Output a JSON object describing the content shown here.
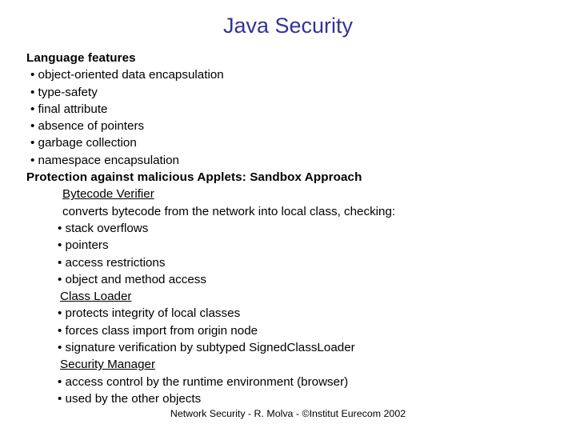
{
  "slide": {
    "title": "Java Security",
    "title_color": "#333399",
    "background_color": "#FFFFFF",
    "text_color": "#000000",
    "bullet_glyph": "•"
  },
  "content": {
    "lines": [
      {
        "text": "Language features",
        "style": "bold",
        "indent": "ind-0"
      },
      {
        "text": "• object-oriented data encapsulation",
        "style": "normal",
        "indent": "ind-bullet1"
      },
      {
        "text": "• type-safety",
        "style": "normal",
        "indent": "ind-bullet1"
      },
      {
        "text": "• final attribute",
        "style": "normal",
        "indent": "ind-bullet1"
      },
      {
        "text": "• absence of pointers",
        "style": "normal",
        "indent": "ind-bullet1"
      },
      {
        "text": "• garbage collection",
        "style": "normal",
        "indent": "ind-bullet1"
      },
      {
        "text": "• namespace encapsulation",
        "style": "normal",
        "indent": "ind-bullet1"
      },
      {
        "text": "Protection against malicious Applets: Sandbox Approach",
        "style": "bold",
        "indent": "ind-0"
      },
      {
        "text": "Bytecode Verifier",
        "style": "underline",
        "indent": "ind-sub-head"
      },
      {
        "text": "converts bytecode from the network into local class, checking:",
        "style": "normal",
        "indent": "ind-sub-text"
      },
      {
        "text": "• stack overflows",
        "style": "normal",
        "indent": "ind-sub-bullet"
      },
      {
        "text": "• pointers",
        "style": "normal",
        "indent": "ind-sub-bullet"
      },
      {
        "text": "• access restrictions",
        "style": "normal",
        "indent": "ind-sub-bullet"
      },
      {
        "text": "• object and method access",
        "style": "normal",
        "indent": "ind-sub-bullet"
      },
      {
        "text": "Class Loader",
        "style": "underline",
        "indent": "ind-sub-head-2"
      },
      {
        "text": "• protects integrity of local classes",
        "style": "normal",
        "indent": "ind-sub-bullet"
      },
      {
        "text": "• forces class import from origin node",
        "style": "normal",
        "indent": "ind-sub-bullet"
      },
      {
        "text": "• signature verification by subtyped SignedClassLoader",
        "style": "normal",
        "indent": "ind-sub-bullet"
      },
      {
        "text": "Security Manager",
        "style": "underline",
        "indent": "ind-sub-head-2"
      },
      {
        "text": "• access control by the runtime environment (browser)",
        "style": "normal",
        "indent": "ind-sub-bullet"
      },
      {
        "text": "• used by the other objects",
        "style": "normal",
        "indent": "ind-sub-bullet"
      }
    ]
  },
  "footer": {
    "text": "Network Security - R. Molva - ©Institut Eurecom 2002"
  }
}
